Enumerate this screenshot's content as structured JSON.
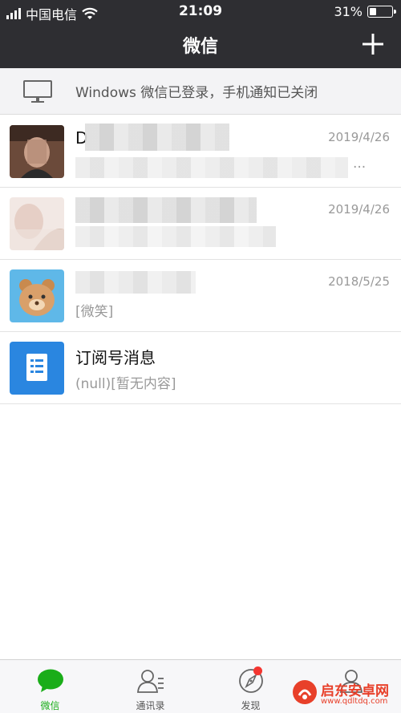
{
  "status_bar": {
    "carrier": "中国电信",
    "time": "21:09",
    "battery": "31%",
    "battery_level": 0.31
  },
  "nav": {
    "title": "微信",
    "add_icon": "plus-icon"
  },
  "banner": {
    "icon": "monitor-icon",
    "text": "Windows 微信已登录，手机通知已关闭"
  },
  "chats": [
    {
      "name": "D",
      "time": "2019/4/26",
      "preview": "..."
    },
    {
      "name": "",
      "time": "2019/4/26",
      "preview": ""
    },
    {
      "name": "",
      "time": "2018/5/25",
      "preview": "[微笑]"
    },
    {
      "name": "订阅号消息",
      "time": "",
      "preview": "(null)[暂无内容]"
    }
  ],
  "tabs": [
    {
      "label": "微信",
      "icon": "chat-bubble-icon",
      "active": true
    },
    {
      "label": "通讯录",
      "icon": "contacts-icon",
      "active": false
    },
    {
      "label": "发现",
      "icon": "compass-icon",
      "active": false
    },
    {
      "label": "",
      "icon": "profile-icon",
      "active": false
    }
  ],
  "watermark": {
    "title": "启东安卓网",
    "url": "www.qdltdq.com"
  },
  "colors": {
    "bar_dark": "#2e2e32",
    "wechat_green": "#1aad19",
    "badge_red": "#f43530",
    "subscription_blue": "#2a86e0"
  }
}
